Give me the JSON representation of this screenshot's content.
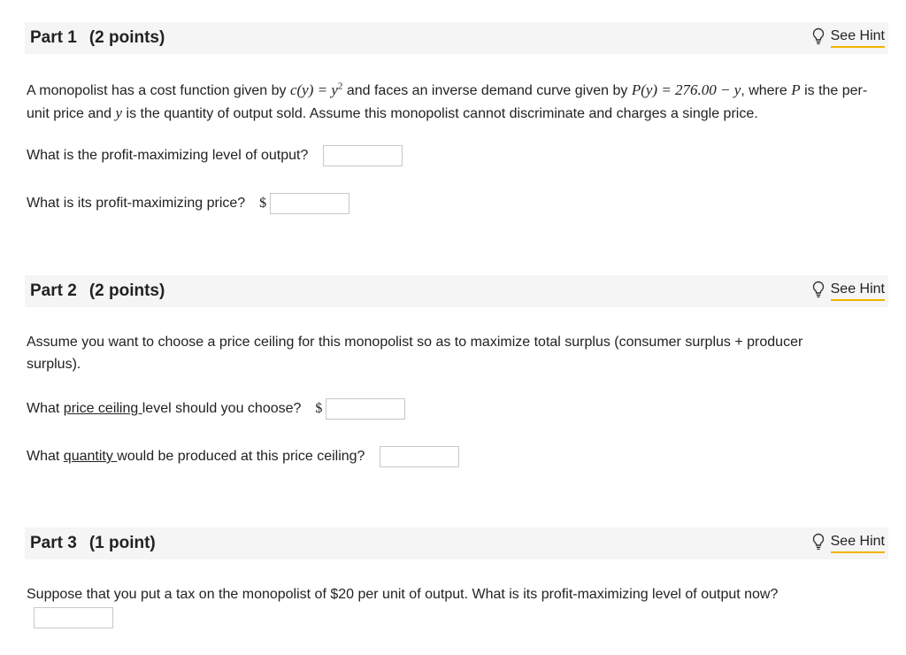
{
  "hint_label": "See Hint",
  "part1": {
    "title": "Part 1",
    "points": "(2 points)",
    "intro": {
      "t1": "A monopolist has a cost function given by ",
      "cost_fn": "c(y) = y",
      "exp": "2",
      "t2": " and faces an inverse demand curve given by ",
      "demand_fn": "P(y) = 276.00 − y",
      "t3": ", where ",
      "P": "P",
      "t4": " is the per-unit price and ",
      "y": "y",
      "t5": " is the quantity of output sold. Assume this monopolist cannot discriminate and charges a single price."
    },
    "q1": "What is the profit-maximizing level of output?",
    "q2": "What is its profit-maximizing price?",
    "currency": "$"
  },
  "part2": {
    "title": "Part 2",
    "points": "(2 points)",
    "intro": "Assume you want to choose a price ceiling for this monopolist so as to maximize total surplus (consumer surplus + producer surplus).",
    "q1_pre": "What ",
    "q1_link": "price ceiling ",
    "q1_post": "level should you choose?",
    "q2_pre": "What ",
    "q2_link": "quantity ",
    "q2_post": "would be produced at this price ceiling?",
    "currency": "$"
  },
  "part3": {
    "title": "Part 3",
    "points": "(1 point)",
    "intro": "Suppose that you put a tax on the monopolist of $20 per unit of output. What is its profit-maximizing level of output now?"
  },
  "answers": {
    "p1_output": "",
    "p1_price": "",
    "p2_ceiling": "",
    "p2_quantity": "",
    "p3_output": ""
  },
  "colors": {
    "header_bg": "#f5f5f5",
    "hint_underline": "#f0b400",
    "box_border": "#c8c8c8"
  }
}
